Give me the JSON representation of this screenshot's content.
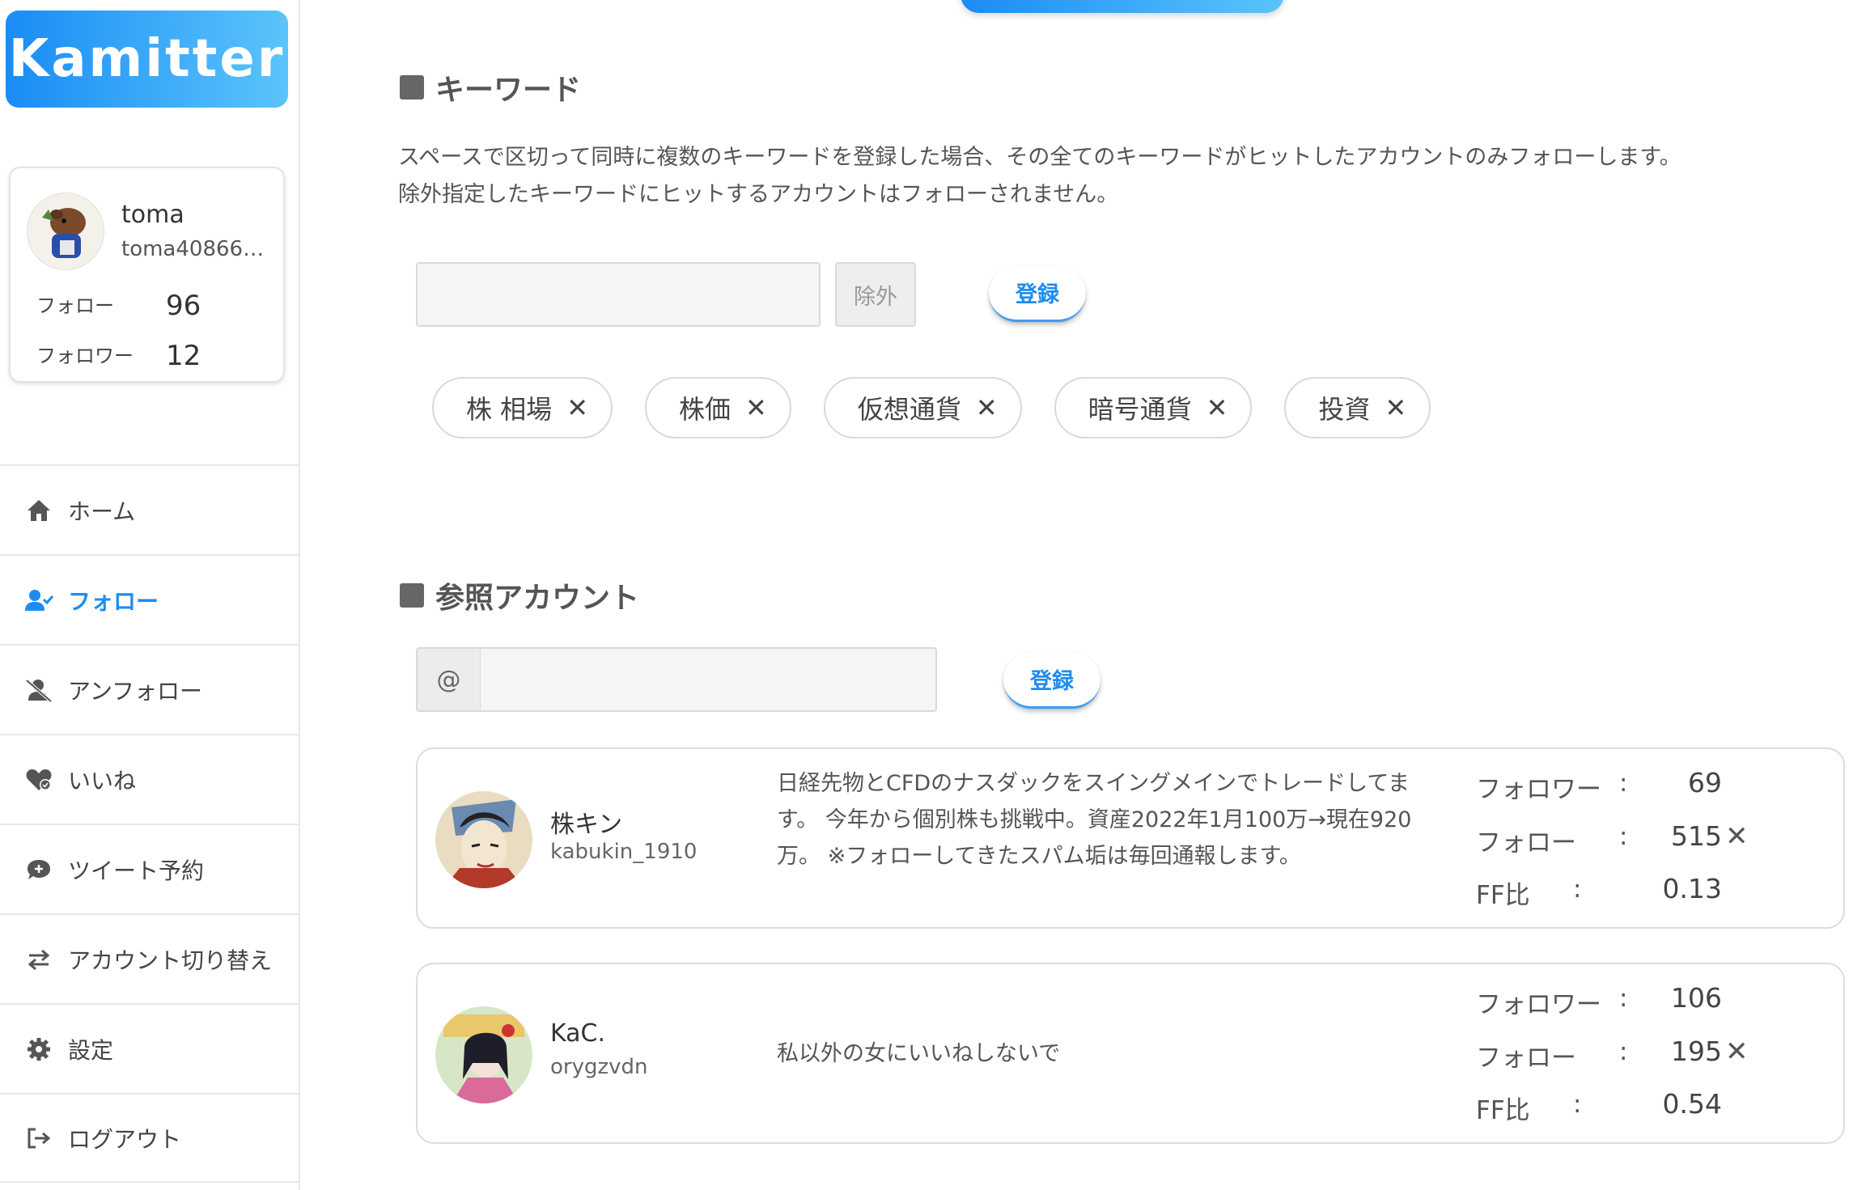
{
  "app": {
    "logo": "Kamitter"
  },
  "profile": {
    "name": "toma",
    "handle": "toma40866…",
    "follow_label": "フォロー",
    "follow_count": "96",
    "follower_label": "フォロワー",
    "follower_count": "12"
  },
  "nav": [
    {
      "label": "ホーム",
      "icon": "home-icon"
    },
    {
      "label": "フォロー",
      "icon": "user-check-icon",
      "active": true
    },
    {
      "label": "アンフォロー",
      "icon": "user-slash-icon"
    },
    {
      "label": "いいね",
      "icon": "heart-icon"
    },
    {
      "label": "ツイート予約",
      "icon": "comment-plus-icon"
    },
    {
      "label": "アカウント切り替え",
      "icon": "swap-icon"
    },
    {
      "label": "設定",
      "icon": "gear-icon"
    },
    {
      "label": "ログアウト",
      "icon": "logout-icon"
    }
  ],
  "keyword": {
    "title": "キーワード",
    "description": "スペースで区切って同時に複数のキーワードを登録した場合、その全てのキーワードがヒットしたアカウントのみフォローします。 除外指定したキーワードにヒットするアカウントはフォローされません。",
    "input_value": "",
    "exclude_label": "除外",
    "register_label": "登録",
    "tags": [
      "株 相場",
      "株価",
      "仮想通貨",
      "暗号通貨",
      "投資"
    ],
    "tag_close": "✕"
  },
  "reference": {
    "title": "参照アカウント",
    "at_prefix": "@",
    "input_value": "",
    "register_label": "登録",
    "stat_labels": {
      "followers": "フォロワー",
      "following": "フォロー",
      "ff": "FF比"
    },
    "colon": ":",
    "close": "✕",
    "accounts": [
      {
        "name": "株キン",
        "handle": "kabukin_1910",
        "bio": "日経先物とCFDのナスダックをスイングメインでトレードしてます。 今年から個別株も挑戦中。資産2022年1月100万→現在920万。 ※フォローしてきたスパム垢は毎回通報します。",
        "followers": "69",
        "following": "515",
        "ff": "0.13"
      },
      {
        "name": "KaC.",
        "handle": "orygzvdn",
        "bio": "私以外の女にいいねしないで",
        "followers": "106",
        "following": "195",
        "ff": "0.54"
      }
    ]
  },
  "colors": {
    "accent": "#1d8cf0",
    "logo_gradient_start": "#1a8cf5",
    "logo_gradient_end": "#5bc4fb"
  }
}
